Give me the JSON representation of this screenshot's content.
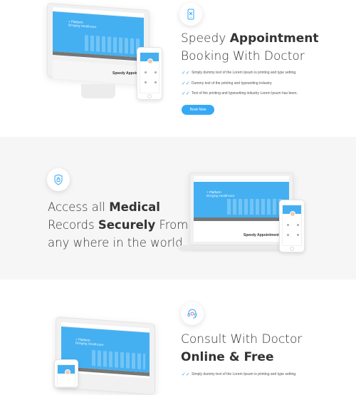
{
  "features": [
    {
      "heading_light_1": "Speedy ",
      "heading_bold_1": "Appointment",
      "heading_light_2": "Booking With Doctor",
      "icon": "mobile-booking-icon",
      "checklist": [
        "Simply dummy text of the Lorem Ipsum is printing and type setting.",
        "Dummy text of the printing and typesetting industry.",
        "Text of the printing and typesetting industry Lorem Ipsum has been."
      ],
      "button_label": "Book Now",
      "mockup": {
        "hero_line_1": "+ Platform",
        "hero_line_2": "Bringing Healthcare",
        "caption": "Speedy Appointment"
      }
    },
    {
      "heading_light_1": "Access all ",
      "heading_bold_1": "Medical",
      "heading_light_2": "Records ",
      "heading_bold_2": "Securely",
      "heading_light_3": " From",
      "heading_light_4": "any where in the world.",
      "icon": "secure-lock-icon",
      "mockup": {
        "hero_line_1": "+ Platform",
        "hero_line_2": "Bringing Healthcare",
        "caption": "Speedy Appointment"
      }
    },
    {
      "heading_light_1": "Consult With Doctor",
      "heading_bold_1": "Online & Free",
      "icon": "headset-doctor-icon",
      "checklist": [
        "Simply dummy text of the Lorem Ipsum is printing and type setting."
      ],
      "mockup": {
        "hero_line_1": "+ Platform",
        "hero_line_2": "Bringing Healthcare"
      }
    }
  ],
  "colors": {
    "accent": "#35a9f6",
    "hero_blue": "#44b0f2",
    "section_gray": "#f7f6f7"
  }
}
